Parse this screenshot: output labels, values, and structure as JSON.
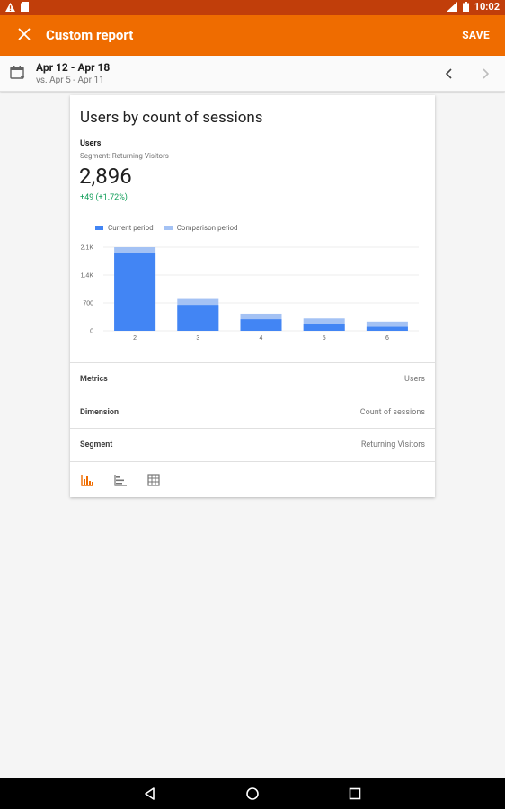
{
  "status_bar": {
    "time": "10:02",
    "network": "3G"
  },
  "app_bar": {
    "title": "Custom report",
    "save_label": "SAVE"
  },
  "date_bar": {
    "range": "Apr 12 - Apr 18",
    "comparison": "vs. Apr 5 - Apr 11"
  },
  "card": {
    "title": "Users by count of sessions",
    "metric_name": "Users",
    "segment_line": "Segment: Returning Visitors",
    "value": "2,896",
    "delta": "+49 (+1.72%)"
  },
  "legend": {
    "current": "Current period",
    "comparison": "Comparison period"
  },
  "colors": {
    "accent": "#ef6c00",
    "current": "#4285f4",
    "comparison": "#a4c2f4",
    "positive": "#0f9d58"
  },
  "chart_data": {
    "type": "bar",
    "categories": [
      "2",
      "3",
      "4",
      "5",
      "6"
    ],
    "series": [
      {
        "name": "Current period",
        "values": [
          1950,
          650,
          290,
          160,
          100
        ]
      },
      {
        "name": "Comparison period",
        "values": [
          2100,
          800,
          430,
          310,
          230
        ]
      }
    ],
    "yticks": [
      "0",
      "700",
      "1.4K",
      "2.1K"
    ],
    "ytick_values": [
      0,
      700,
      1400,
      2100
    ],
    "ylim": [
      0,
      2100
    ],
    "grid": true,
    "legend_position": "top-left"
  },
  "details": [
    {
      "key": "Metrics",
      "value": "Users"
    },
    {
      "key": "Dimension",
      "value": "Count of sessions"
    },
    {
      "key": "Segment",
      "value": "Returning Visitors"
    }
  ],
  "view_icons": [
    "bar-chart-icon",
    "horizontal-bar-icon",
    "table-icon"
  ],
  "nav_icons": [
    "back-icon",
    "home-icon",
    "recents-icon"
  ]
}
